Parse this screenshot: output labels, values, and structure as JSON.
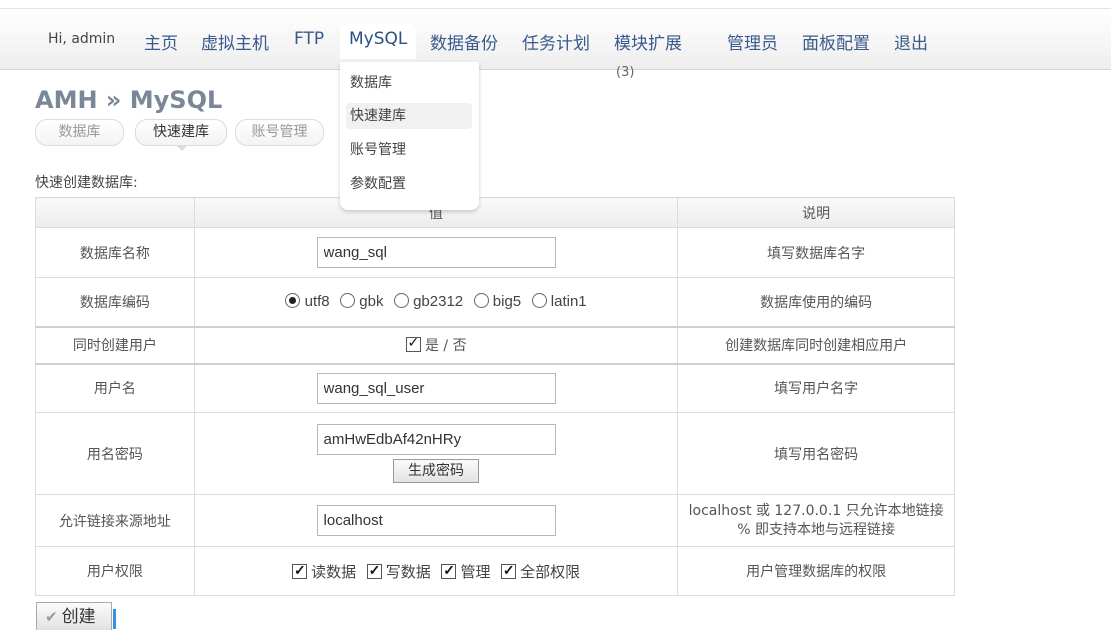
{
  "header": {
    "greeting": "Hi, admin"
  },
  "nav": {
    "items": [
      {
        "label": "主页"
      },
      {
        "label": "虚拟主机"
      },
      {
        "label": "FTP"
      },
      {
        "label": "MySQL"
      },
      {
        "label": "数据备份"
      },
      {
        "label": "任务计划"
      },
      {
        "label": "模块扩展"
      },
      {
        "label": "管理员"
      },
      {
        "label": "面板配置"
      },
      {
        "label": "退出"
      }
    ],
    "module_badge": "(3)"
  },
  "dropdown": {
    "items": [
      {
        "label": "数据库"
      },
      {
        "label": "快速建库"
      },
      {
        "label": "账号管理"
      },
      {
        "label": "参数配置"
      }
    ],
    "hovered": "快速建库"
  },
  "page": {
    "title": "AMH » MySQL",
    "subtabs": [
      {
        "label": "数据库"
      },
      {
        "label": "快速建库"
      },
      {
        "label": "账号管理"
      }
    ],
    "active_subtab": "快速建库",
    "section_label": "快速创建数据库:"
  },
  "table": {
    "headers": [
      "",
      "值",
      "说明"
    ],
    "db_name": {
      "label": "数据库名称",
      "value": "wang_sql",
      "desc": "填写数据库名字"
    },
    "db_encoding": {
      "label": "数据库编码",
      "options": [
        "utf8",
        "gbk",
        "gb2312",
        "big5",
        "latin1"
      ],
      "selected": "utf8",
      "desc": "数据库使用的编码"
    },
    "create_user": {
      "label": "同时创建用户",
      "yes": "是",
      "sep": "/",
      "no": "否",
      "checked": true,
      "desc": "创建数据库同时创建相应用户"
    },
    "username": {
      "label": "用户名",
      "value": "wang_sql_user",
      "desc": "填写用户名字"
    },
    "password": {
      "label": "用名密码",
      "value": "amHwEdbAf42nHRy",
      "gen_button": "生成密码",
      "desc": "填写用名密码"
    },
    "host": {
      "label": "允许链接来源地址",
      "value": "localhost",
      "desc_line1": "localhost 或 127.0.0.1 只允许本地链接",
      "desc_line2": "% 即支持本地与远程链接"
    },
    "privileges": {
      "label": "用户权限",
      "options": [
        "读数据",
        "写数据",
        "管理",
        "全部权限"
      ],
      "desc": "用户管理数据库的权限"
    }
  },
  "submit": {
    "label": "创建"
  },
  "colors": {
    "nav_text": "#3a5a8c",
    "title": "#7a8796",
    "caret": "#3a8ee6"
  }
}
